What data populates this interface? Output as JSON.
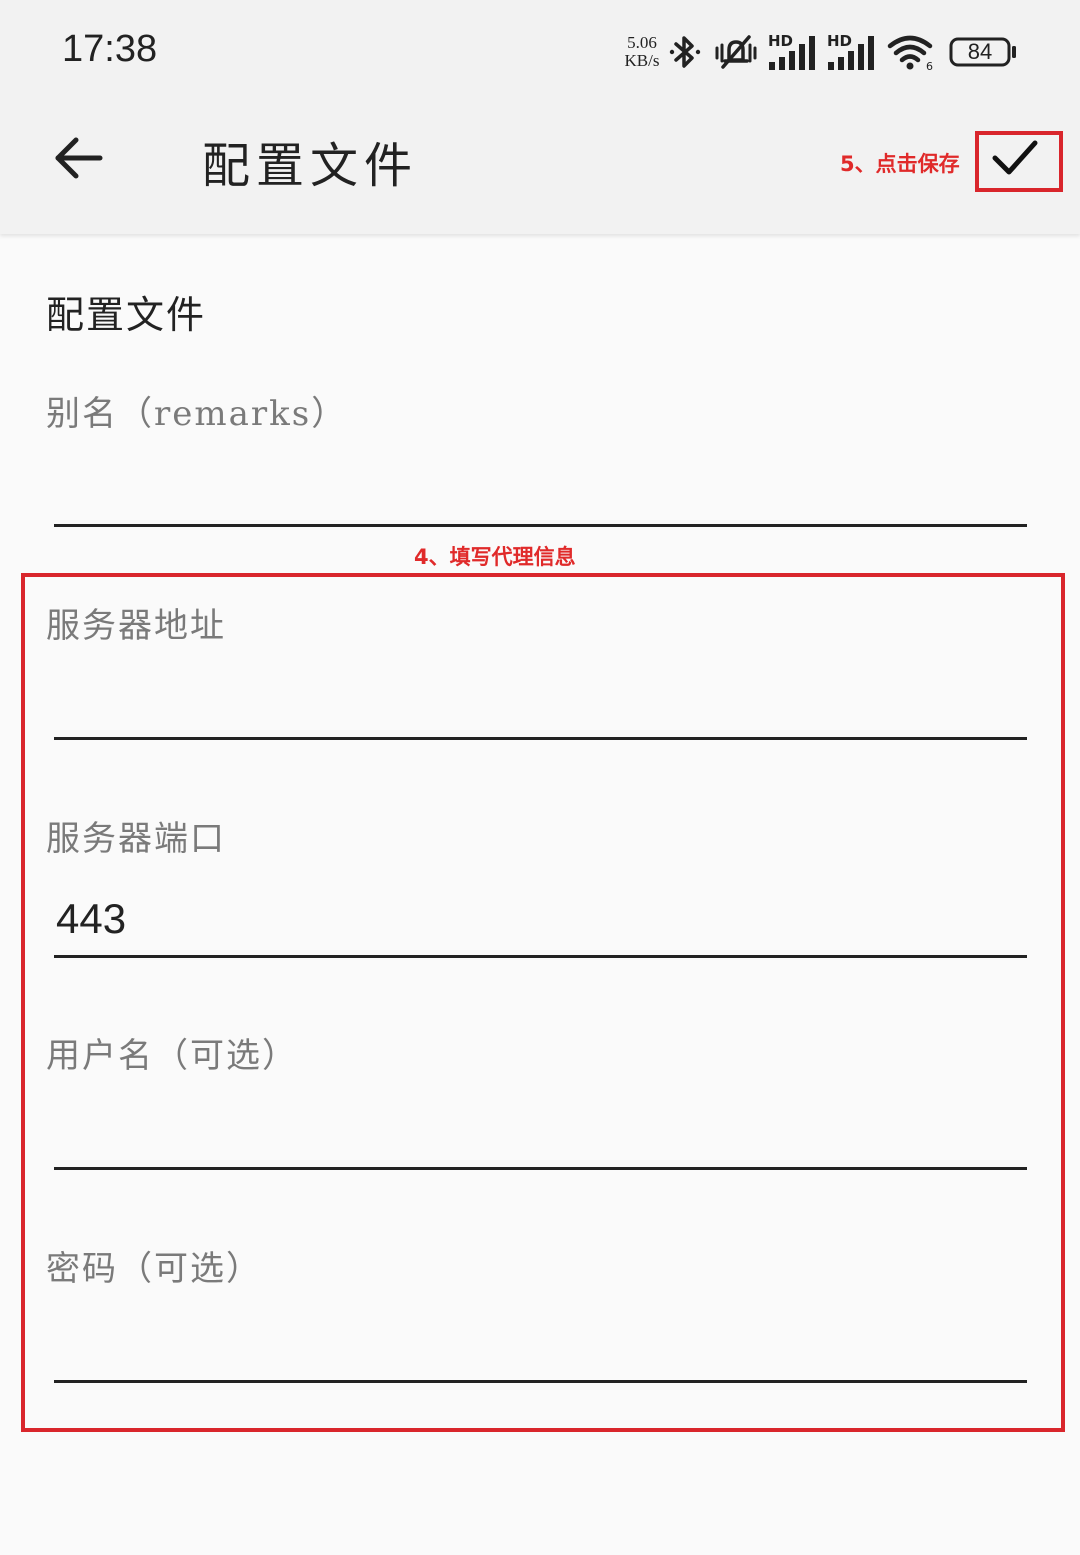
{
  "status_bar": {
    "time": "17:38",
    "net_speed_value": "5.06",
    "net_speed_unit": "KB/s",
    "icons": [
      "bluetooth-icon",
      "mute-vibrate-icon",
      "hd-signal-1-icon",
      "hd-signal-2-icon",
      "wifi-icon",
      "battery-icon"
    ],
    "hd_label": "HD",
    "wifi_badge": "6",
    "battery": "84"
  },
  "toolbar": {
    "back_icon": "arrow-left-icon",
    "title": "配置文件",
    "save_hint": "5、点击保存",
    "save_icon": "check-icon"
  },
  "form": {
    "section_title": "配置文件",
    "fill_hint": "4、填写代理信息",
    "fields": [
      {
        "label": "别名（remarks）",
        "value": ""
      },
      {
        "label": "服务器地址",
        "value": ""
      },
      {
        "label": "服务器端口",
        "value": "443"
      },
      {
        "label": "用户名（可选）",
        "value": ""
      },
      {
        "label": "密码（可选）",
        "value": ""
      }
    ]
  },
  "colors": {
    "annotation_red": "#d9262c",
    "annotation_text": "#e02a2a",
    "toolbar_bg": "#f2f2f2",
    "page_bg": "#fafafa"
  }
}
